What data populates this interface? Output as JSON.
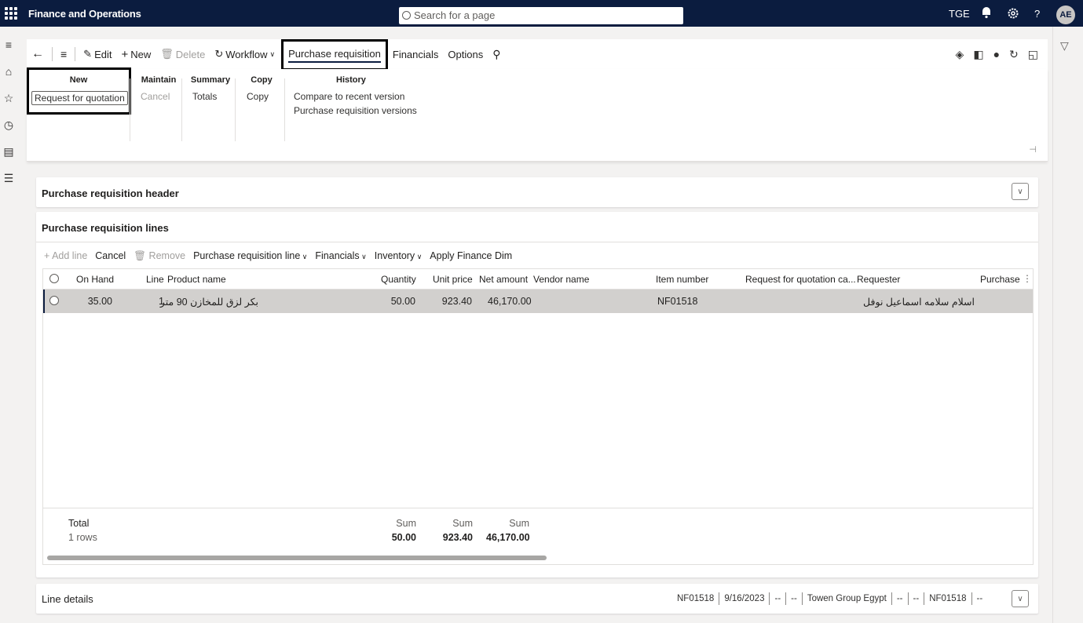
{
  "topbar": {
    "app_title": "Finance and Operations",
    "search_placeholder": "Search for a page",
    "company": "TGE",
    "avatar_initials": "AE",
    "help": "?"
  },
  "actionbar": {
    "edit": "Edit",
    "new": "New",
    "delete": "Delete",
    "workflow": "Workflow",
    "tab_purchase_requisition": "Purchase requisition",
    "tab_financials": "Financials",
    "tab_options": "Options"
  },
  "ribbon": {
    "groups": {
      "new": {
        "header": "New",
        "items": [
          "Request for quotation"
        ]
      },
      "maintain": {
        "header": "Maintain",
        "items": [
          "Cancel"
        ]
      },
      "summary": {
        "header": "Summary",
        "items": [
          "Totals"
        ]
      },
      "copy": {
        "header": "Copy",
        "items": [
          "Copy"
        ]
      },
      "history": {
        "header": "History",
        "items": [
          "Compare to recent version",
          "Purchase requisition versions"
        ]
      }
    }
  },
  "header_section": {
    "title": "Purchase requisition header"
  },
  "lines_section": {
    "title": "Purchase requisition lines",
    "toolbar": {
      "add_line": "Add line",
      "cancel": "Cancel",
      "remove": "Remove",
      "purchase_requisition_line": "Purchase requisition line",
      "financials": "Financials",
      "inventory": "Inventory",
      "apply_finance_dim": "Apply Finance Dim"
    },
    "columns": {
      "on_hand": "On Hand",
      "line": "Line",
      "product_name": "Product name",
      "quantity": "Quantity",
      "unit_price": "Unit price",
      "net_amount": "Net amount",
      "vendor_name": "Vendor name",
      "item_number": "Item number",
      "rfq_case": "Request for quotation ca...",
      "requester": "Requester",
      "purchase": "Purchase"
    },
    "rows": [
      {
        "on_hand": "35.00",
        "line": "1",
        "product_name": "بكر لزق للمخازن 90 متر",
        "quantity": "50.00",
        "unit_price": "923.40",
        "net_amount": "46,170.00",
        "vendor_name": "",
        "item_number": "NF01518",
        "rfq_case": "",
        "requester": "اسلام سلامه اسماعيل نوفل",
        "purchase": ""
      }
    ],
    "footer": {
      "total_label": "Total",
      "rows_count": "1 rows",
      "sum_label": "Sum",
      "quantity_sum": "50.00",
      "unit_price_sum": "923.40",
      "net_amount_sum": "46,170.00"
    }
  },
  "line_details": {
    "title": "Line details",
    "summary": [
      "NF01518",
      "9/16/2023",
      "--",
      "--",
      "Towen Group Egypt",
      "--",
      "--",
      "NF01518",
      "--"
    ]
  }
}
